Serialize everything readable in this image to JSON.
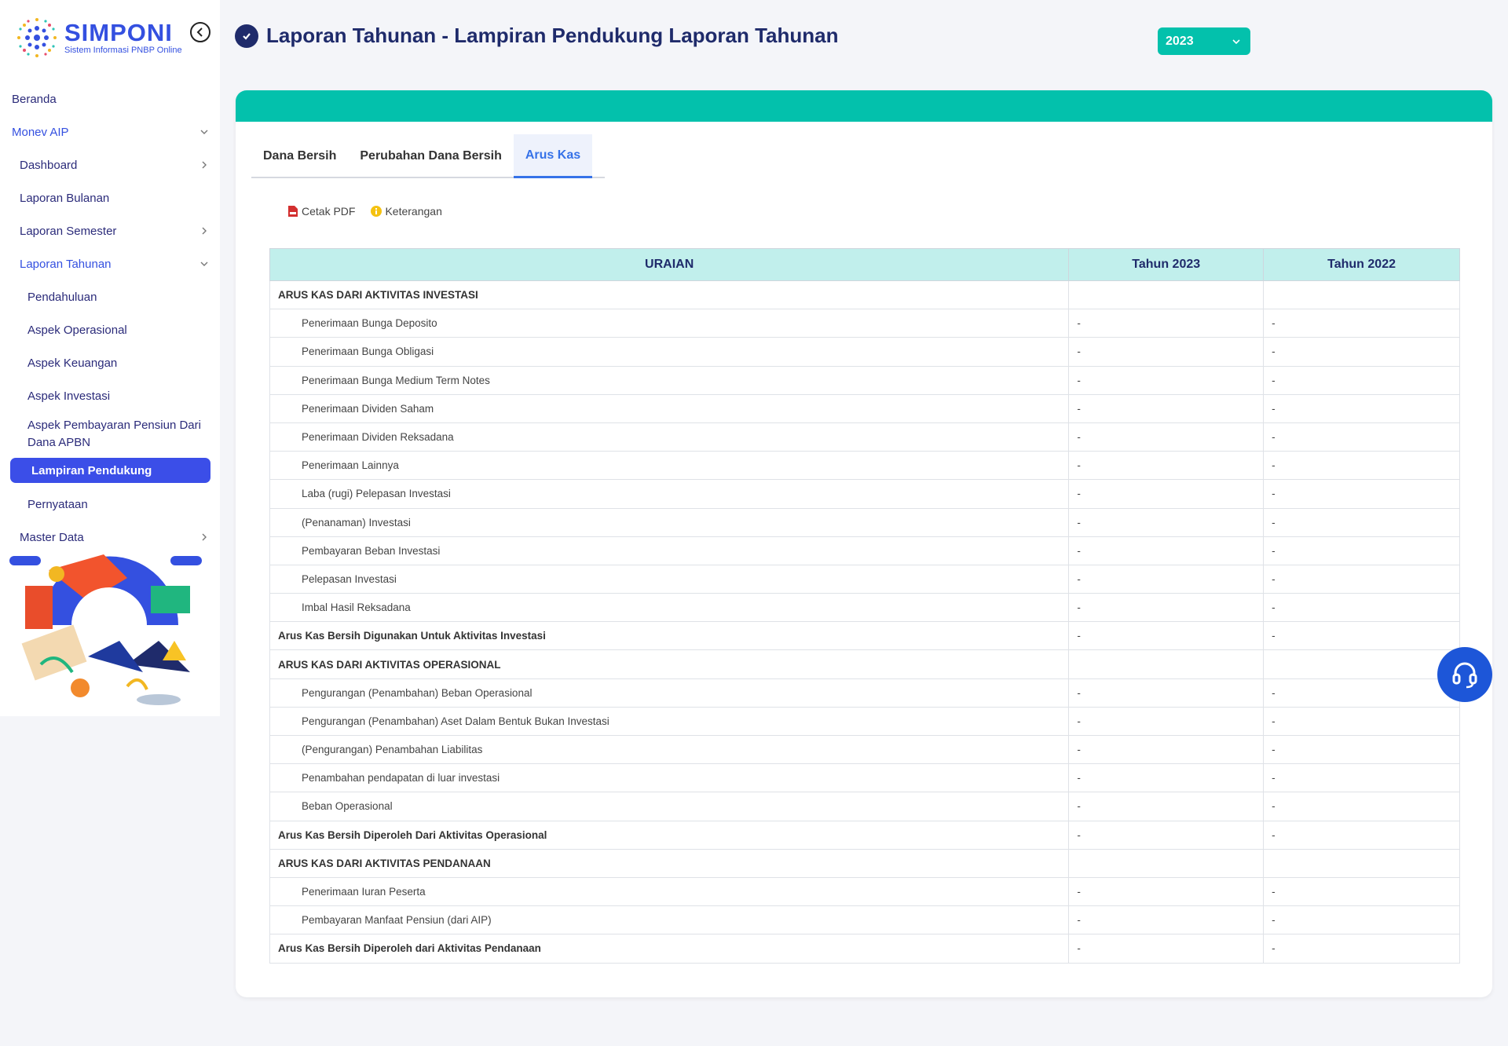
{
  "brand": {
    "title": "SIMPONI",
    "subtitle": "Sistem Informasi PNBP Online"
  },
  "sidebar": {
    "items": [
      {
        "label": "Beranda"
      },
      {
        "label": "Monev AIP"
      },
      {
        "label": "Dashboard"
      },
      {
        "label": "Laporan Bulanan"
      },
      {
        "label": "Laporan Semester"
      },
      {
        "label": "Laporan Tahunan"
      },
      {
        "label": "Pendahuluan"
      },
      {
        "label": "Aspek Operasional"
      },
      {
        "label": "Aspek Keuangan"
      },
      {
        "label": "Aspek Investasi"
      },
      {
        "label": "Aspek Pembayaran Pensiun Dari Dana APBN"
      },
      {
        "label": "Lampiran Pendukung"
      },
      {
        "label": "Pernyataan"
      },
      {
        "label": "Master Data"
      }
    ]
  },
  "header": {
    "title": "Laporan Tahunan - Lampiran Pendukung Laporan Tahunan",
    "year": "2023"
  },
  "tabs": [
    {
      "label": "Dana Bersih"
    },
    {
      "label": "Perubahan Dana Bersih"
    },
    {
      "label": "Arus Kas"
    }
  ],
  "actions": {
    "pdf": "Cetak PDF",
    "info": "Keterangan"
  },
  "table": {
    "headers": [
      "URAIAN",
      "Tahun 2023",
      "Tahun 2022"
    ],
    "rows": [
      {
        "label": "ARUS KAS DARI AKTIVITAS INVESTASI",
        "y2023": "",
        "y2022": ""
      },
      {
        "label": "Penerimaan Bunga Deposito",
        "y2023": "-",
        "y2022": "-"
      },
      {
        "label": "Penerimaan Bunga Obligasi",
        "y2023": "-",
        "y2022": "-"
      },
      {
        "label": "Penerimaan Bunga Medium Term Notes",
        "y2023": "-",
        "y2022": "-"
      },
      {
        "label": "Penerimaan Dividen Saham",
        "y2023": "-",
        "y2022": "-"
      },
      {
        "label": "Penerimaan Dividen Reksadana",
        "y2023": "-",
        "y2022": "-"
      },
      {
        "label": "Penerimaan Lainnya",
        "y2023": "-",
        "y2022": "-"
      },
      {
        "label": "Laba (rugi) Pelepasan Investasi",
        "y2023": "-",
        "y2022": "-"
      },
      {
        "label": "(Penanaman) Investasi",
        "y2023": "-",
        "y2022": "-"
      },
      {
        "label": "Pembayaran Beban Investasi",
        "y2023": "-",
        "y2022": "-"
      },
      {
        "label": "Pelepasan Investasi",
        "y2023": "-",
        "y2022": "-"
      },
      {
        "label": "Imbal Hasil Reksadana",
        "y2023": "-",
        "y2022": "-"
      },
      {
        "label": "Arus Kas Bersih Digunakan Untuk Aktivitas Investasi",
        "y2023": "-",
        "y2022": "-"
      },
      {
        "label": "ARUS KAS DARI AKTIVITAS OPERASIONAL",
        "y2023": "",
        "y2022": ""
      },
      {
        "label": "Pengurangan (Penambahan) Beban Operasional",
        "y2023": "-",
        "y2022": "-"
      },
      {
        "label": "Pengurangan (Penambahan) Aset Dalam Bentuk Bukan Investasi",
        "y2023": "-",
        "y2022": "-"
      },
      {
        "label": "(Pengurangan) Penambahan Liabilitas",
        "y2023": "-",
        "y2022": "-"
      },
      {
        "label": "Penambahan pendapatan di luar investasi",
        "y2023": "-",
        "y2022": "-"
      },
      {
        "label": "Beban Operasional",
        "y2023": "-",
        "y2022": "-"
      },
      {
        "label": "Arus Kas Bersih Diperoleh Dari Aktivitas Operasional",
        "y2023": "-",
        "y2022": "-"
      },
      {
        "label": "ARUS KAS DARI AKTIVITAS PENDANAAN",
        "y2023": "",
        "y2022": ""
      },
      {
        "label": "Penerimaan Iuran Peserta",
        "y2023": "-",
        "y2022": "-"
      },
      {
        "label": "Pembayaran Manfaat Pensiun (dari AIP)",
        "y2023": "-",
        "y2022": "-"
      },
      {
        "label": "Arus Kas Bersih Diperoleh dari Aktivitas Pendanaan",
        "y2023": "-",
        "y2022": "-"
      }
    ]
  },
  "colors": {
    "accent": "#03c1ac",
    "primary": "#3b4ee8",
    "title": "#1f2b6b",
    "tab_active": "#3672e8"
  },
  "icons": [
    "back-circle-icon",
    "check-circle-icon",
    "chevron-down-icon",
    "chevron-right-icon",
    "pdf-icon",
    "info-icon",
    "headset-icon"
  ]
}
